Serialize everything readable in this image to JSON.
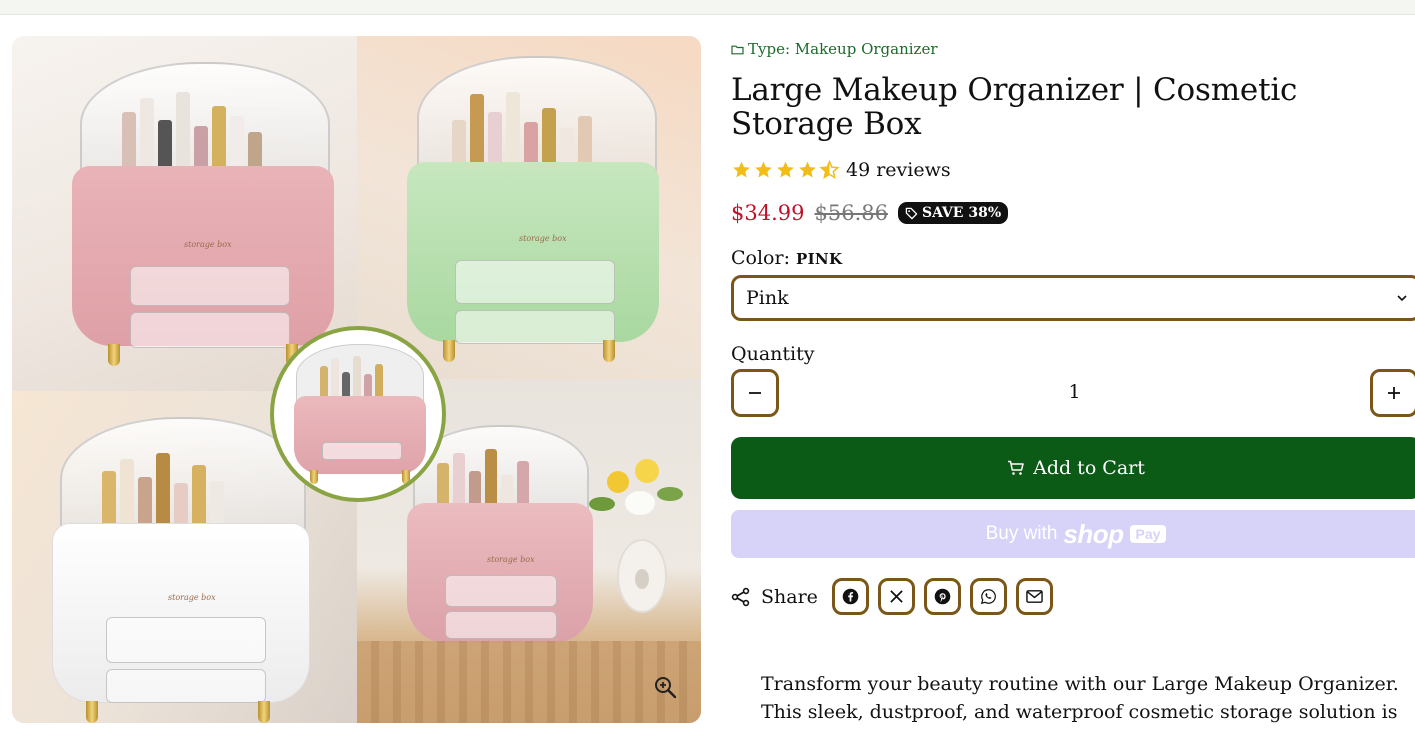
{
  "product": {
    "type_label": "Type: Makeup Organizer",
    "title": "Large Makeup Organizer | Cosmetic Storage Box",
    "rating": 4.5,
    "reviews_label": "49 reviews",
    "price": "$34.99",
    "compare_price": "$56.86",
    "save_badge": "SAVE 38%",
    "color_label": "Color:",
    "color_value": "PINK",
    "color_select_value": "Pink",
    "quantity_label": "Quantity",
    "quantity_value": "1",
    "add_to_cart_label": "Add to Cart",
    "buy_with_label": "Buy with",
    "shop_label": "shop",
    "pay_label": "Pay",
    "share_label": "Share",
    "description": "Transform your beauty routine with our Large Makeup Organizer. This sleek, dustproof, and waterproof cosmetic storage solution is"
  },
  "share_icons": [
    "facebook-icon",
    "x-icon",
    "pinterest-icon",
    "whatsapp-icon",
    "email-icon"
  ],
  "gallery": {
    "variants": [
      "pink",
      "green",
      "white",
      "pink"
    ],
    "brand_text": "storage box"
  },
  "colors": {
    "accent_border": "#7a5618",
    "cart_green": "#0b5a16",
    "price_red": "#c0102a",
    "shop_pay": "#d6d2f8",
    "type_green": "#1d6b2c"
  }
}
